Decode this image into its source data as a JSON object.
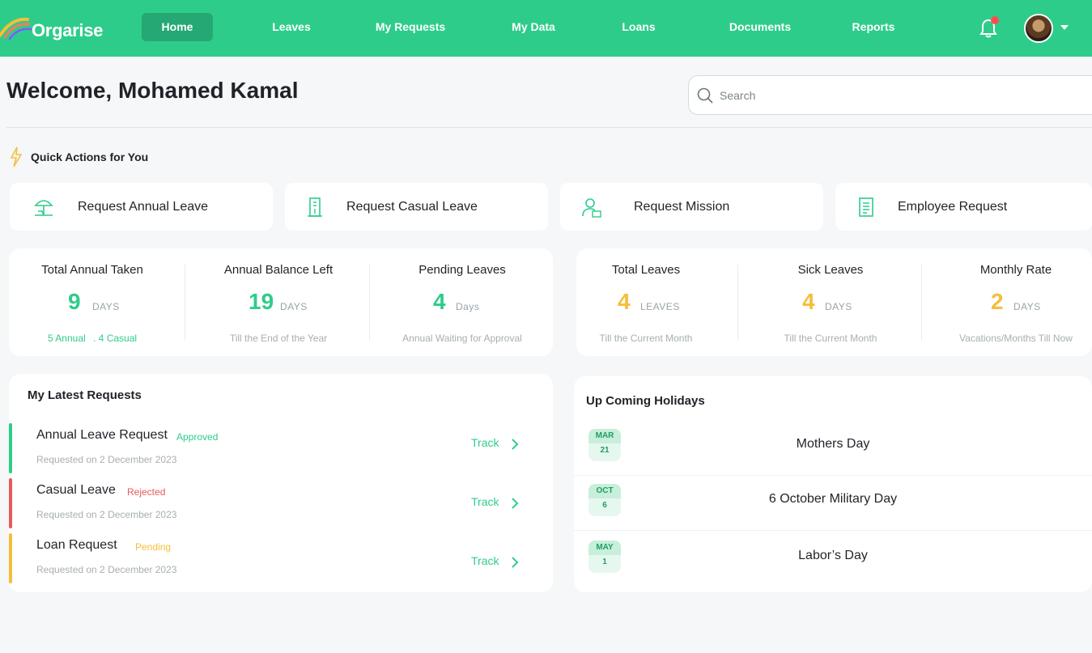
{
  "app": {
    "name": "Orgarise"
  },
  "nav": {
    "items": [
      {
        "label": "Home"
      },
      {
        "label": "Leaves"
      },
      {
        "label": "My Requests"
      },
      {
        "label": "My Data"
      },
      {
        "label": "Loans"
      },
      {
        "label": "Documents"
      },
      {
        "label": "Reports"
      }
    ],
    "active": "Home"
  },
  "header": {
    "welcome": "Welcome, Mohamed Kamal",
    "search_placeholder": "Search"
  },
  "quick_actions": {
    "title": "Quick Actions for You",
    "items": [
      {
        "label": "Request Annual Leave",
        "icon": "beach-umbrella-icon"
      },
      {
        "label": "Request Casual Leave",
        "icon": "door-icon"
      },
      {
        "label": "Request Mission",
        "icon": "user-briefcase-icon"
      },
      {
        "label": "Employee Request",
        "icon": "document-icon"
      }
    ]
  },
  "stats_left": [
    {
      "title": "Total Annual Taken",
      "value": "9",
      "unit": "DAYS",
      "sub_a": "5 Annual",
      "sub_b": ". 4 Casual"
    },
    {
      "title": "Annual Balance Left",
      "value": "19",
      "unit": "DAYS",
      "sub": "Till the End of the Year"
    },
    {
      "title": "Pending Leaves",
      "value": "4",
      "unit": "Days",
      "sub": "Annual Waiting for Approval"
    }
  ],
  "stats_right": [
    {
      "title": "Total Leaves",
      "value": "4",
      "unit": "LEAVES",
      "sub": "Till the Current Month"
    },
    {
      "title": "Sick Leaves",
      "value": "4",
      "unit": "DAYS",
      "sub": "Till the Current Month"
    },
    {
      "title": "Monthly Rate",
      "value": "2",
      "unit": "DAYS",
      "sub": "Vacations/Months Till Now"
    }
  ],
  "requests": {
    "title": "My Latest Requests",
    "track_label": "Track",
    "items": [
      {
        "name": "Annual Leave Request",
        "status": "Approved",
        "date": "Requested on 2 December 2023",
        "color": "#2ecc8a"
      },
      {
        "name": "Casual Leave",
        "status": "Rejected",
        "date": "Requested on 2 December 2023",
        "color": "#e85a5a"
      },
      {
        "name": "Loan Request",
        "status": "Pending",
        "date": "Requested on 2 December 2023",
        "color": "#f5be3a"
      }
    ]
  },
  "holidays": {
    "title": "Up Coming Holidays",
    "items": [
      {
        "month": "MAR",
        "day": "21",
        "name": "Mothers Day"
      },
      {
        "month": "OCT",
        "day": "6",
        "name": "6 October Military Day"
      },
      {
        "month": "MAY",
        "day": "1",
        "name": "Labor’s Day"
      }
    ]
  }
}
